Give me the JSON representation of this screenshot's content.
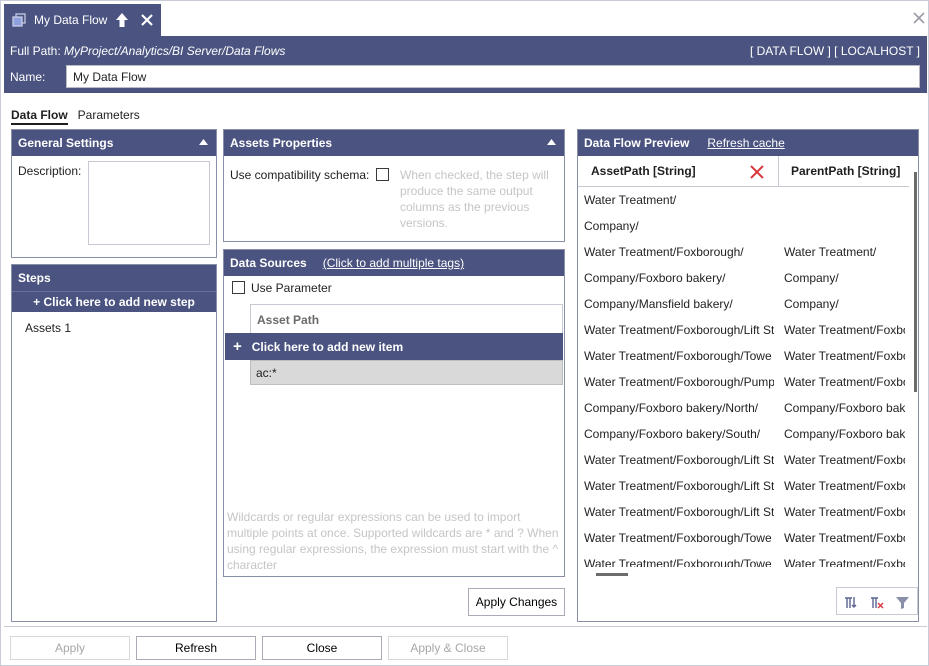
{
  "tab": {
    "title": "My Data Flow"
  },
  "header": {
    "full_path_label": "Full Path:",
    "full_path_value": "MyProject/Analytics/BI Server/Data Flows",
    "context_tags": "[ DATA FLOW ] [ LOCALHOST ]",
    "name_label": "Name:",
    "name_value": "My Data Flow"
  },
  "main_tabs": [
    {
      "label": "Data Flow",
      "active": true
    },
    {
      "label": "Parameters",
      "active": false
    }
  ],
  "general_settings": {
    "title": "General Settings",
    "description_label": "Description:",
    "description_value": ""
  },
  "steps": {
    "title": "Steps",
    "add_label": "+ Click here to add new step",
    "items": [
      "Assets 1"
    ]
  },
  "assets_properties": {
    "title": "Assets Properties",
    "compat_label": "Use compatibility schema:",
    "compat_checked": false,
    "compat_hint": "When checked, the step will produce the same output columns as the previous versions."
  },
  "data_sources": {
    "title": "Data Sources",
    "link": "(Click to add multiple tags)",
    "use_parameter_label": "Use Parameter",
    "use_parameter_checked": false,
    "column_header": "Asset Path",
    "add_item_label": "Click here to add new item",
    "items": [
      "ac:*"
    ],
    "hint": "Wildcards or regular expressions can be used to import multiple points at once. Supported wildcards are * and ? When using regular expressions, the expression must start with the ^ character",
    "apply_changes": "Apply Changes"
  },
  "preview": {
    "title": "Data Flow Preview",
    "refresh_link": "Refresh cache",
    "columns": [
      "AssetPath  [String]",
      "ParentPath  [String]"
    ],
    "rows": [
      [
        "Water Treatment/",
        ""
      ],
      [
        "Company/",
        ""
      ],
      [
        "Water Treatment/Foxborough/",
        "Water Treatment/"
      ],
      [
        "Company/Foxboro bakery/",
        "Company/"
      ],
      [
        "Company/Mansfield bakery/",
        "Company/"
      ],
      [
        "Water Treatment/Foxborough/Lift St",
        "Water Treatment/Foxbo"
      ],
      [
        "Water Treatment/Foxborough/Towe",
        "Water Treatment/Foxbo"
      ],
      [
        "Water Treatment/Foxborough/Pump",
        "Water Treatment/Foxbo"
      ],
      [
        "Company/Foxboro bakery/North/",
        "Company/Foxboro bak"
      ],
      [
        "Company/Foxboro bakery/South/",
        "Company/Foxboro bak"
      ],
      [
        "Water Treatment/Foxborough/Lift St",
        "Water Treatment/Foxbo"
      ],
      [
        "Water Treatment/Foxborough/Lift St",
        "Water Treatment/Foxbo"
      ],
      [
        "Water Treatment/Foxborough/Lift St",
        "Water Treatment/Foxbo"
      ],
      [
        "Water Treatment/Foxborough/Towe",
        "Water Treatment/Foxbo"
      ],
      [
        "Water Treatment/Foxborough/Towe",
        "Water Treatment/Foxbo"
      ]
    ]
  },
  "footer": {
    "apply": "Apply",
    "refresh": "Refresh",
    "close": "Close",
    "apply_close": "Apply & Close"
  },
  "colors": {
    "accent": "#4b5480",
    "remove_red": "#d9363e"
  }
}
